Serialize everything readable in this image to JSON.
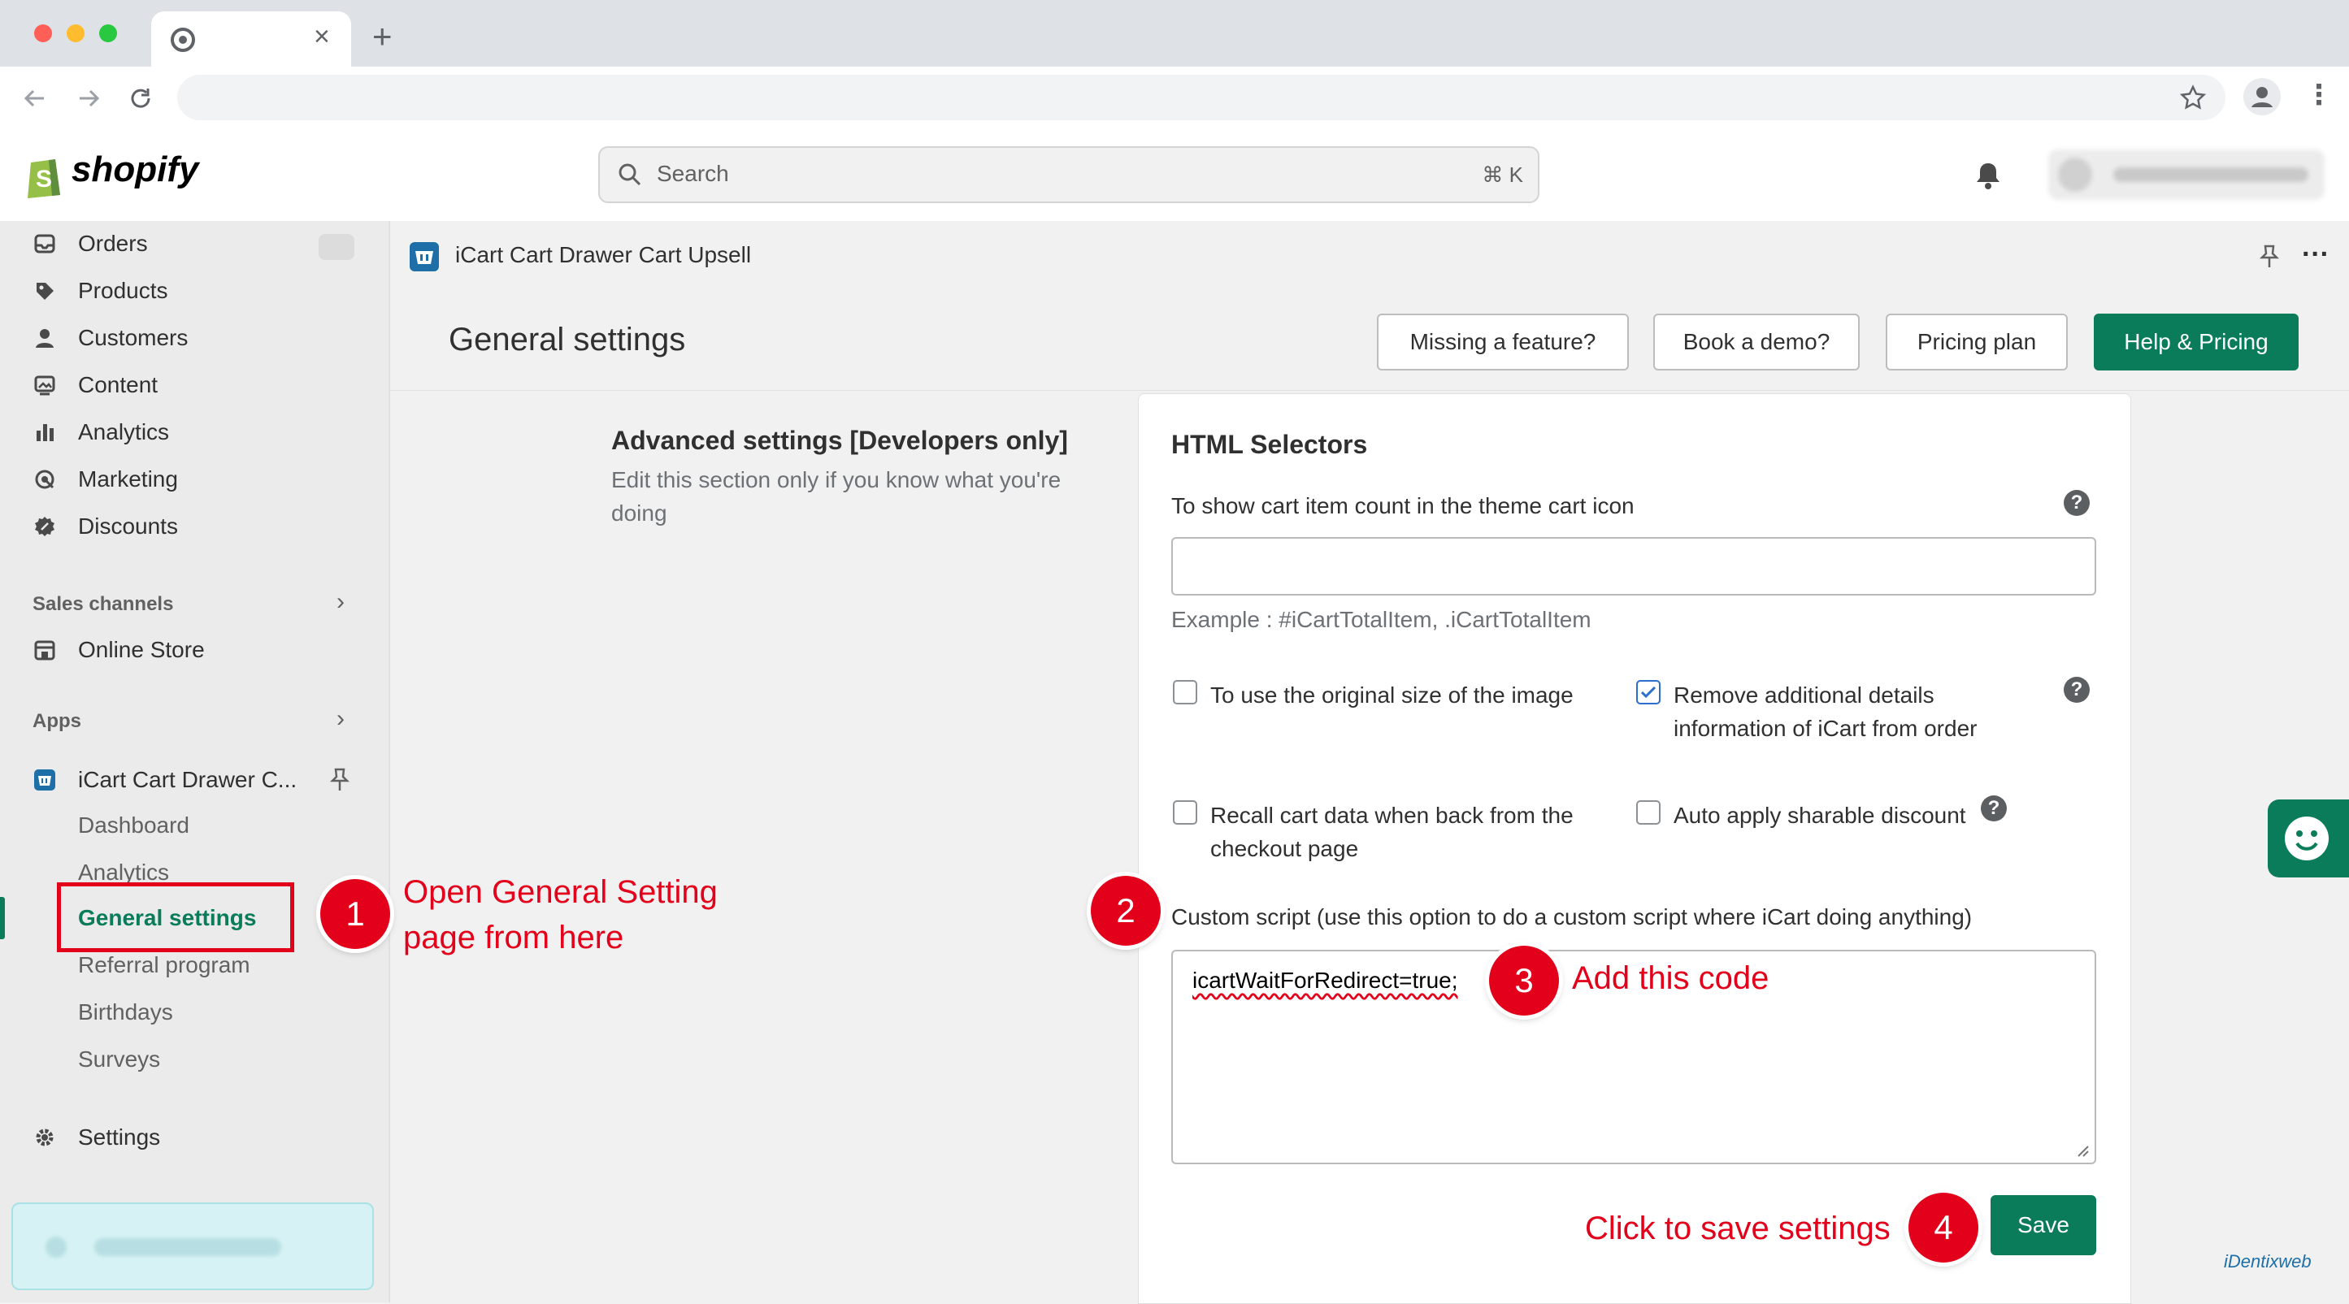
{
  "browser": {
    "tab_close": "×",
    "new_tab": "+"
  },
  "header": {
    "logo_text": "shopify",
    "search_placeholder": "Search",
    "search_shortcut": "⌘ K"
  },
  "sidebar": {
    "items": [
      {
        "label": "Orders",
        "icon": "inbox-icon"
      },
      {
        "label": "Products",
        "icon": "tag-icon"
      },
      {
        "label": "Customers",
        "icon": "person-icon"
      },
      {
        "label": "Content",
        "icon": "image-icon"
      },
      {
        "label": "Analytics",
        "icon": "bar-chart-icon"
      },
      {
        "label": "Marketing",
        "icon": "target-icon"
      },
      {
        "label": "Discounts",
        "icon": "discount-icon"
      }
    ],
    "sales_channels_heading": "Sales channels",
    "online_store": "Online Store",
    "apps_heading": "Apps",
    "app_name": "iCart Cart Drawer C...",
    "app_subitems": [
      "Dashboard",
      "Analytics",
      "General settings",
      "Referral program",
      "Birthdays",
      "Surveys"
    ],
    "settings": "Settings"
  },
  "app": {
    "title": "iCart Cart Drawer Cart Upsell",
    "more": "···"
  },
  "page": {
    "title": "General settings",
    "buttons": [
      "Missing a feature?",
      "Book a demo?",
      "Pricing plan",
      "Help & Pricing"
    ]
  },
  "advanced": {
    "heading": "Advanced settings [Developers only]",
    "description": "Edit this section only if you know what you're doing"
  },
  "selectors": {
    "heading": "HTML Selectors",
    "cart_count_label": "To show cart item count in the theme cart icon",
    "cart_count_value": "",
    "example": "Example : #iCartTotalItem, .iCartTotalItem",
    "opt_original_size": "To use the original size of the image",
    "opt_remove_details": "Remove additional details information of iCart from order",
    "opt_recall_cart": "Recall cart data when back from the checkout page",
    "opt_auto_discount": "Auto apply sharable discount",
    "custom_script_label": "Custom script (use this option to do a custom script where iCart doing anything)",
    "custom_script_value": "icartWaitForRedirect=true;",
    "save": "Save"
  },
  "checkboxes": {
    "original_size": false,
    "remove_details": true,
    "recall_cart": false,
    "auto_discount": false
  },
  "annotations": {
    "n1": "1",
    "n2": "2",
    "n3": "3",
    "n4": "4",
    "step1_line1": "Open General Setting",
    "step1_line2": "page from here",
    "step3": "Add this code",
    "step4": "Click to save settings"
  },
  "watermark": "iDentixweb",
  "colors": {
    "primary": "#0b7c5a",
    "annotation": "#e3001b",
    "accent_check": "#2c6ecb"
  }
}
